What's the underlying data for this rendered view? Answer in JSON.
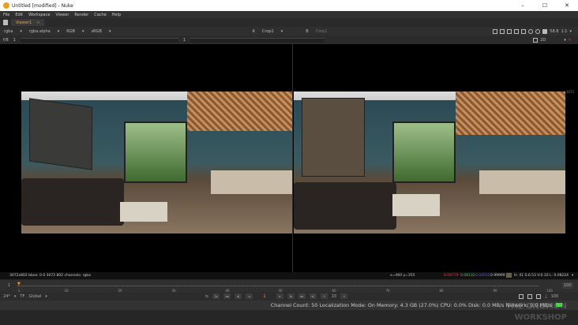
{
  "window": {
    "title": "Untitled [modified] - Nuke",
    "min": "–",
    "max": "☐",
    "close": "✕"
  },
  "menu": [
    "File",
    "Edit",
    "Workspace",
    "Viewer",
    "Render",
    "Cache",
    "Help"
  ],
  "tab": {
    "label": "Viewer1",
    "close": "×"
  },
  "toolbar": {
    "channels": "rgba",
    "alpha": "rgba.alpha",
    "display": "RGB",
    "colorspace": "sRGB",
    "input_a_label": "A",
    "input_a": "Crop1",
    "input_b_label": "B",
    "input_b": "Crop1",
    "zoom_pct": "58.8",
    "ratio": "1:1"
  },
  "toolbar2": {
    "fstop": "f/8",
    "frame": "1",
    "gamma_value": "1",
    "view_mode": "2D"
  },
  "viewer": {
    "image_label": "3072"
  },
  "info": {
    "format": "3072x802  bbox: 0 0 3072 802 channels: rgba",
    "coords": "x=460 y=355",
    "r": "0.09779",
    "g": "0.08132",
    "b": "0.04552",
    "a": "0.99999",
    "hsvl": "H: 41 S:0.53 V:0.10  L: 0.08224",
    "colors": {
      "r": "#e04040",
      "g": "#60c060",
      "b": "#6060e0",
      "swatch": "#6b5d4a"
    }
  },
  "timeline": {
    "start": "1",
    "end": "100",
    "current_frame": "1",
    "ticks": [
      "1",
      "10",
      "20",
      "30",
      "40",
      "50",
      "60",
      "70",
      "80",
      "90",
      "100"
    ]
  },
  "controls": {
    "fps": "24*",
    "tf": "TF",
    "scope": "Global",
    "frame": "1",
    "step": "10",
    "end_frame": "100"
  },
  "status": "Channel Count: 50 Localization Mode: On Memory: 4.3 GB (27.0%) CPU: 0.0% Disk: 0.0 MB/s Network: 0.0 MB/s",
  "watermark": "THE GNOMON WORKSHOP"
}
